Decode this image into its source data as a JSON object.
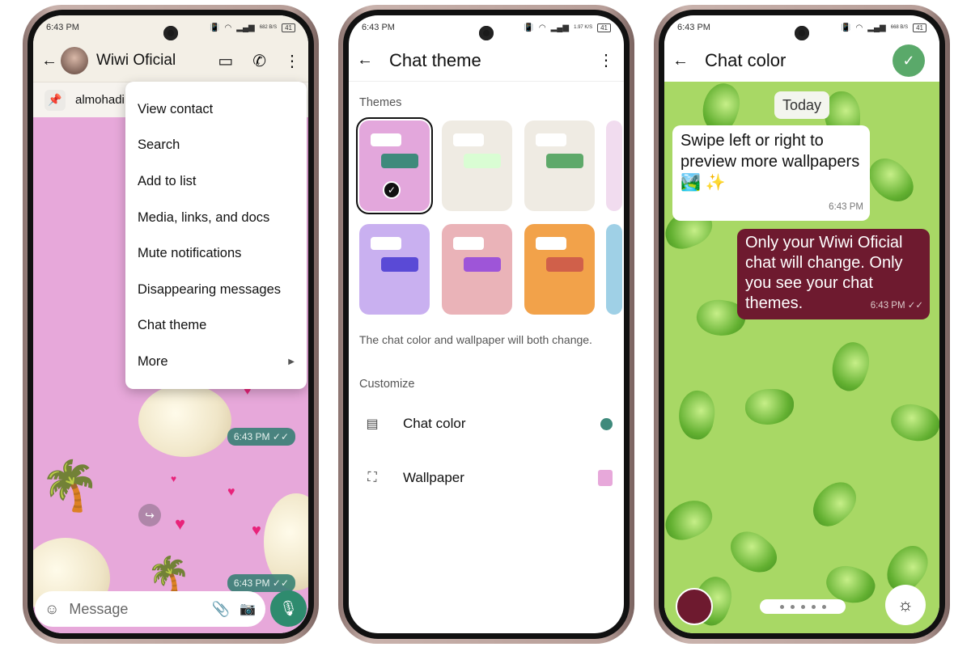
{
  "phones": [
    {
      "status": {
        "time": "6:43 PM",
        "speed": "682 B/S",
        "battery": "41"
      },
      "header": {
        "contact": "Wiwi Oficial"
      },
      "pinned": "almohadi",
      "menu": [
        "View contact",
        "Search",
        "Add to list",
        "Media, links, and docs",
        "Mute notifications",
        "Disappearing messages",
        "Chat theme",
        "More"
      ],
      "bubbles": [
        "6:43 PM ✓✓",
        "6:43 PM ✓✓"
      ],
      "input": {
        "placeholder": "Message"
      },
      "colors": {
        "chat_bg": "#e7a8da",
        "accent": "#2e8b6e"
      }
    },
    {
      "status": {
        "time": "6:43 PM",
        "speed": "1.97 K/S",
        "battery": "41"
      },
      "header": {
        "title": "Chat theme"
      },
      "themes_label": "Themes",
      "themes": [
        {
          "bg": "#e3a7dc",
          "bubble": "#3f8a7c",
          "selected": true
        },
        {
          "bg": "#efebe3",
          "bubble": "#d9fdd3"
        },
        {
          "bg": "#efebe3",
          "bubble": "#5ea96a"
        },
        {
          "bg": "#c9b0f0",
          "bubble": "#5a4ad6"
        },
        {
          "bg": "#eab3b8",
          "bubble": "#9e55d8"
        },
        {
          "bg": "#f2a24a",
          "bubble": "#d0604a"
        }
      ],
      "description": "The chat color and wallpaper will both change.",
      "customize_label": "Customize",
      "rows": [
        {
          "label": "Chat color",
          "swatch": "#3f8a7c"
        },
        {
          "label": "Wallpaper",
          "swatch": "#e7a8da"
        }
      ]
    },
    {
      "status": {
        "time": "6:43 PM",
        "speed": "668 B/S",
        "battery": "41"
      },
      "header": {
        "title": "Chat color"
      },
      "date_chip": "Today",
      "incoming": {
        "text": "Swipe left or right to preview more wallpapers 🏞️ ✨",
        "time": "6:43 PM"
      },
      "outgoing": {
        "text": "Only your Wiwi Oficial chat will change. Only you see your chat themes.",
        "time": "6:43 PM ✓✓"
      },
      "colors": {
        "bg": "#a8d865",
        "selected_color": "#6e1a2f",
        "confirm": "#5aa96a"
      }
    }
  ]
}
